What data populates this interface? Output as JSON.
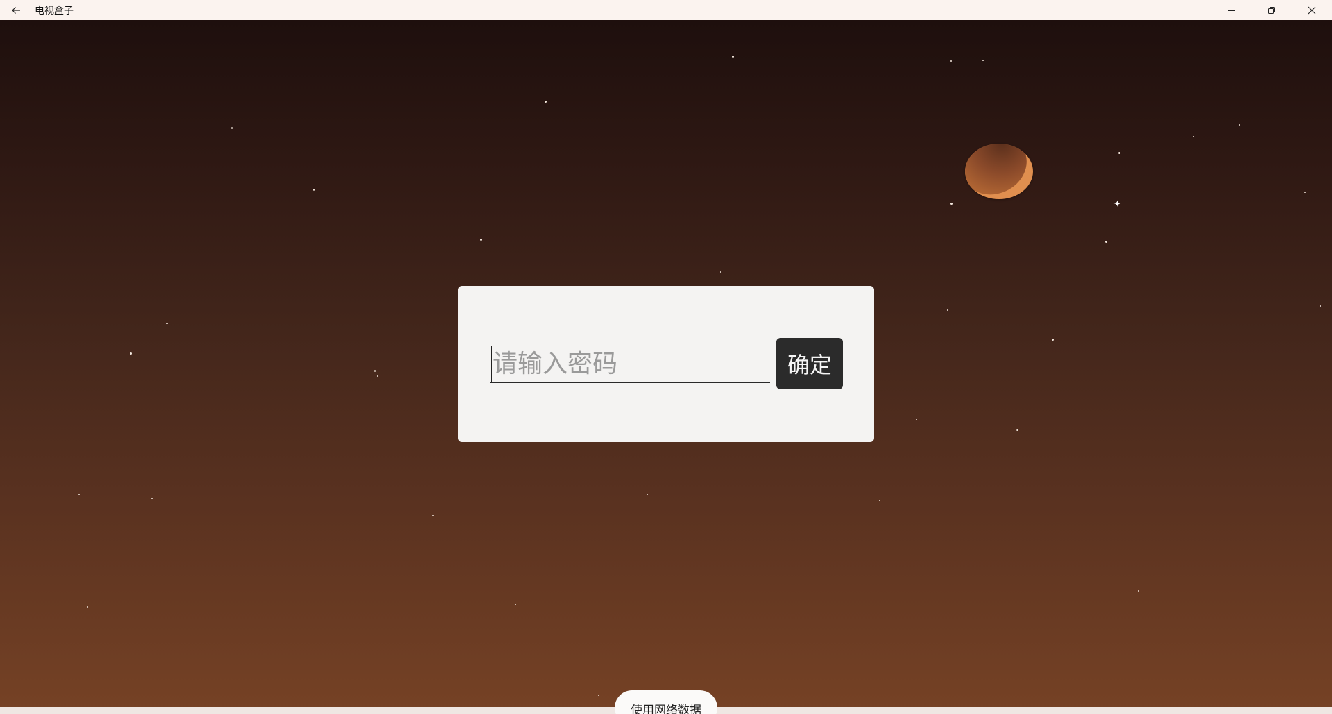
{
  "window": {
    "title": "电视盒子"
  },
  "titlebar": {
    "back_icon": "arrow-left-icon",
    "minimize_icon": "minimize-icon",
    "restore_icon": "restore-icon",
    "close_icon": "close-icon"
  },
  "dialog": {
    "password_placeholder": "请输入密码",
    "password_value": "",
    "confirm_label": "确定"
  },
  "footer": {
    "network_button_label": "使用网络数据"
  },
  "colors": {
    "titlebar_bg": "#fbf3ef",
    "sky_top": "#1e0f0d",
    "sky_bottom": "#764225",
    "planet": "#e08f4f",
    "dialog_bg": "#f4f3f2",
    "confirm_bg": "#2b2b2b"
  }
}
